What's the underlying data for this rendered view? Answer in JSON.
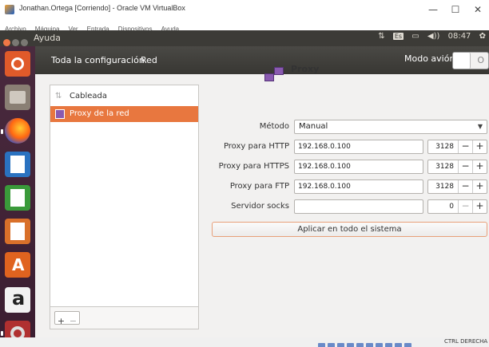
{
  "window": {
    "title": "Jonathan.Ortega [Corriendo] - Oracle VM VirtualBox",
    "minimize": "—",
    "maximize": "☐",
    "close": "✕"
  },
  "vbox_menu": [
    "Archivo",
    "Máquina",
    "Ver",
    "Entrada",
    "Dispositivos",
    "Ayuda"
  ],
  "ubuntu_panel": {
    "app_title": "Ayuda",
    "network_icon": "⇅",
    "keyboard_layout": "Es",
    "battery_icon": "▭",
    "volume_icon": "◀))",
    "time": "08:47",
    "settings_icon": "✿"
  },
  "header": {
    "all_settings": "Toda la configuración",
    "crumb": "Red",
    "airplane_label": "Modo avión",
    "airplane_state": "O"
  },
  "sidebar": {
    "items": [
      {
        "label": "Cableada",
        "icon": "⇅"
      },
      {
        "label": "Proxy de la red"
      }
    ],
    "add": "+",
    "remove": "−"
  },
  "proxy": {
    "title": "Proxy",
    "method_label": "Método",
    "method_value": "Manual",
    "method_arrow": "▼",
    "rows": [
      {
        "label": "Proxy para HTTP",
        "host": "192.168.0.100",
        "port": "3128"
      },
      {
        "label": "Proxy para HTTPS",
        "host": "192.168.0.100",
        "port": "3128"
      },
      {
        "label": "Proxy para FTP",
        "host": "192.168.0.100",
        "port": "3128"
      },
      {
        "label": "Servidor socks",
        "host": "",
        "port": "0"
      }
    ],
    "dec": "−",
    "inc": "+",
    "apply": "Aplicar en todo el sistema"
  },
  "vbox_status": {
    "host_key": "CTRL DERECHA"
  }
}
